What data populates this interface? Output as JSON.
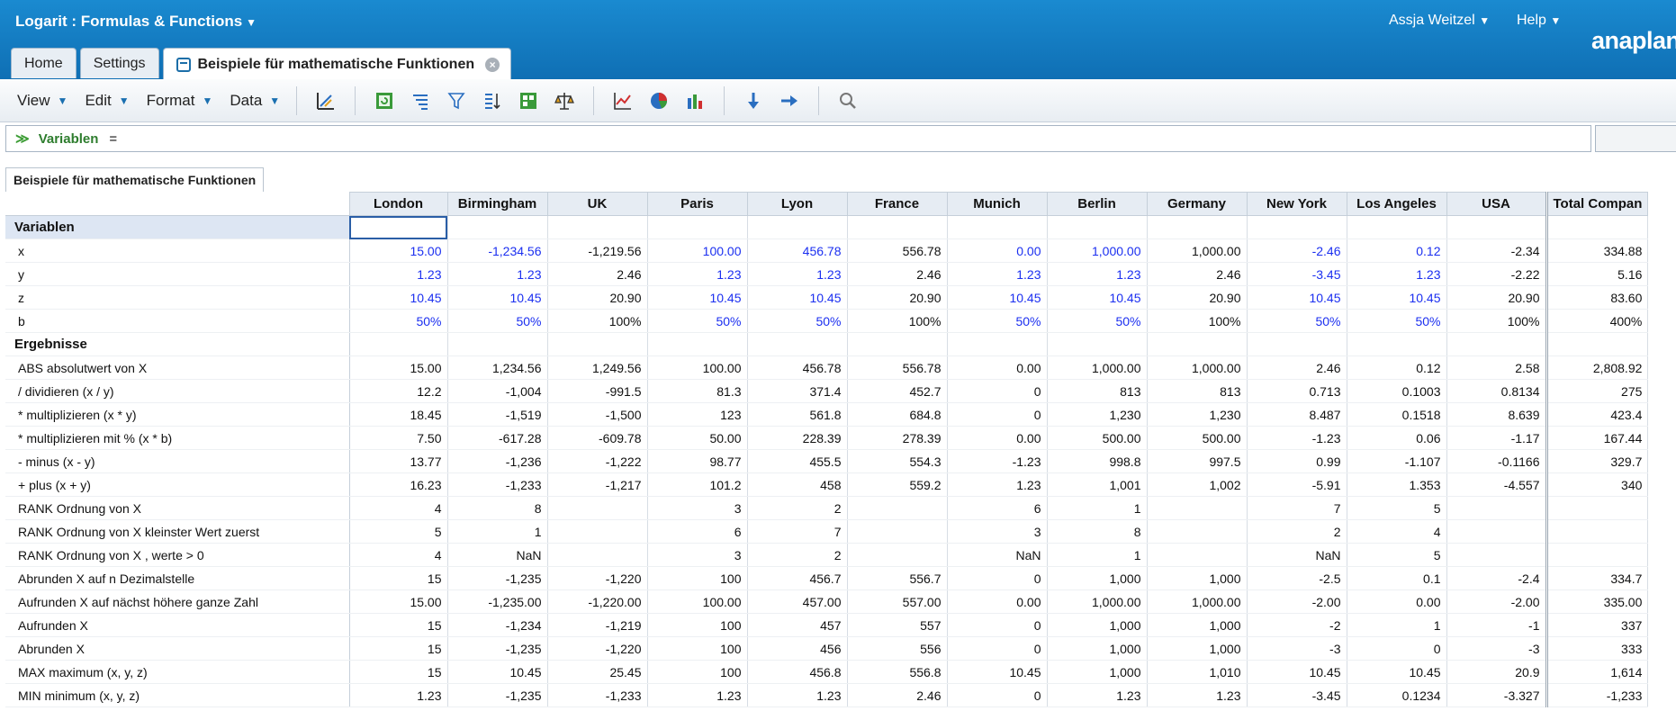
{
  "app": {
    "title": "Logarit : Formulas & Functions",
    "user": "Assja Weitzel",
    "help": "Help",
    "logo": "anaplan"
  },
  "tabs": [
    {
      "label": "Home"
    },
    {
      "label": "Settings"
    },
    {
      "label": "Beispiele für mathematische Funktionen",
      "active": true
    }
  ],
  "menus": [
    "View",
    "Edit",
    "Format",
    "Data"
  ],
  "toolbar_icons": [
    "pivot-icon",
    "refresh-icon",
    "hierarchy-icon",
    "filter-icon",
    "sort-icon",
    "grid-icon",
    "balance-icon",
    "line-chart-icon",
    "pie-chart-icon",
    "bar-chart-icon",
    "arrow-down-icon",
    "arrow-right-icon",
    "search-icon"
  ],
  "formula": {
    "label": "Variablen",
    "equals": "="
  },
  "module_tab": "Beispiele für mathematische Funktionen",
  "columns": [
    "London",
    "Birmingham",
    "UK",
    "Paris",
    "Lyon",
    "France",
    "Munich",
    "Berlin",
    "Germany",
    "New York",
    "Los Angeles",
    "USA",
    "Total Compan"
  ],
  "input_columns": [
    0,
    1,
    3,
    4,
    6,
    7,
    9,
    10
  ],
  "rows": [
    {
      "label": "Variablen",
      "section": true,
      "values": [
        "",
        "",
        "",
        "",
        "",
        "",
        "",
        "",
        "",
        "",
        "",
        "",
        ""
      ]
    },
    {
      "label": "x",
      "input": true,
      "values": [
        "15.00",
        "-1,234.56",
        "-1,219.56",
        "100.00",
        "456.78",
        "556.78",
        "0.00",
        "1,000.00",
        "1,000.00",
        "-2.46",
        "0.12",
        "-2.34",
        "334.88"
      ]
    },
    {
      "label": "y",
      "input": true,
      "values": [
        "1.23",
        "1.23",
        "2.46",
        "1.23",
        "1.23",
        "2.46",
        "1.23",
        "1.23",
        "2.46",
        "-3.45",
        "1.23",
        "-2.22",
        "5.16"
      ]
    },
    {
      "label": "z",
      "input": true,
      "values": [
        "10.45",
        "10.45",
        "20.90",
        "10.45",
        "10.45",
        "20.90",
        "10.45",
        "10.45",
        "20.90",
        "10.45",
        "10.45",
        "20.90",
        "83.60"
      ]
    },
    {
      "label": "b",
      "input": true,
      "values": [
        "50%",
        "50%",
        "100%",
        "50%",
        "50%",
        "100%",
        "50%",
        "50%",
        "100%",
        "50%",
        "50%",
        "100%",
        "400%"
      ]
    },
    {
      "label": "Ergebnisse",
      "section": true,
      "values": [
        "",
        "",
        "",
        "",
        "",
        "",
        "",
        "",
        "",
        "",
        "",
        "",
        ""
      ]
    },
    {
      "label": "ABS absolutwert von X",
      "values": [
        "15.00",
        "1,234.56",
        "1,249.56",
        "100.00",
        "456.78",
        "556.78",
        "0.00",
        "1,000.00",
        "1,000.00",
        "2.46",
        "0.12",
        "2.58",
        "2,808.92"
      ]
    },
    {
      "label": "/ dividieren (x / y)",
      "values": [
        "12.2",
        "-1,004",
        "-991.5",
        "81.3",
        "371.4",
        "452.7",
        "0",
        "813",
        "813",
        "0.713",
        "0.1003",
        "0.8134",
        "275"
      ]
    },
    {
      "label": "* multiplizieren (x * y)",
      "values": [
        "18.45",
        "-1,519",
        "-1,500",
        "123",
        "561.8",
        "684.8",
        "0",
        "1,230",
        "1,230",
        "8.487",
        "0.1518",
        "8.639",
        "423.4"
      ]
    },
    {
      "label": "* multiplizieren mit % (x * b)",
      "values": [
        "7.50",
        "-617.28",
        "-609.78",
        "50.00",
        "228.39",
        "278.39",
        "0.00",
        "500.00",
        "500.00",
        "-1.23",
        "0.06",
        "-1.17",
        "167.44"
      ]
    },
    {
      "label": "- minus (x - y)",
      "values": [
        "13.77",
        "-1,236",
        "-1,222",
        "98.77",
        "455.5",
        "554.3",
        "-1.23",
        "998.8",
        "997.5",
        "0.99",
        "-1.107",
        "-0.1166",
        "329.7"
      ]
    },
    {
      "label": "+ plus (x + y)",
      "values": [
        "16.23",
        "-1,233",
        "-1,217",
        "101.2",
        "458",
        "559.2",
        "1.23",
        "1,001",
        "1,002",
        "-5.91",
        "1.353",
        "-4.557",
        "340"
      ]
    },
    {
      "label": "RANK Ordnung von X",
      "values": [
        "4",
        "8",
        "",
        "3",
        "2",
        "",
        "6",
        "1",
        "",
        "7",
        "5",
        "",
        ""
      ]
    },
    {
      "label": "RANK Ordnung von X kleinster Wert zuerst",
      "values": [
        "5",
        "1",
        "",
        "6",
        "7",
        "",
        "3",
        "8",
        "",
        "2",
        "4",
        "",
        ""
      ]
    },
    {
      "label": "RANK Ordnung von X , werte > 0",
      "values": [
        "4",
        "NaN",
        "",
        "3",
        "2",
        "",
        "NaN",
        "1",
        "",
        "NaN",
        "5",
        "",
        ""
      ]
    },
    {
      "label": "Abrunden X auf n Dezimalstelle",
      "values": [
        "15",
        "-1,235",
        "-1,220",
        "100",
        "456.7",
        "556.7",
        "0",
        "1,000",
        "1,000",
        "-2.5",
        "0.1",
        "-2.4",
        "334.7"
      ]
    },
    {
      "label": "Aufrunden X auf nächst höhere ganze Zahl",
      "values": [
        "15.00",
        "-1,235.00",
        "-1,220.00",
        "100.00",
        "457.00",
        "557.00",
        "0.00",
        "1,000.00",
        "1,000.00",
        "-2.00",
        "0.00",
        "-2.00",
        "335.00"
      ]
    },
    {
      "label": "Aufrunden X",
      "values": [
        "15",
        "-1,234",
        "-1,219",
        "100",
        "457",
        "557",
        "0",
        "1,000",
        "1,000",
        "-2",
        "1",
        "-1",
        "337"
      ]
    },
    {
      "label": "Abrunden X",
      "values": [
        "15",
        "-1,235",
        "-1,220",
        "100",
        "456",
        "556",
        "0",
        "1,000",
        "1,000",
        "-3",
        "0",
        "-3",
        "333"
      ]
    },
    {
      "label": "MAX maximum (x, y, z)",
      "values": [
        "15",
        "10.45",
        "25.45",
        "100",
        "456.8",
        "556.8",
        "10.45",
        "1,000",
        "1,010",
        "10.45",
        "10.45",
        "20.9",
        "1,614"
      ]
    },
    {
      "label": "MIN minimum (x, y, z)",
      "values": [
        "1.23",
        "-1,235",
        "-1,233",
        "1.23",
        "1.23",
        "2.46",
        "0",
        "1.23",
        "1.23",
        "-3.45",
        "0.1234",
        "-3.327",
        "-1,233"
      ]
    }
  ]
}
